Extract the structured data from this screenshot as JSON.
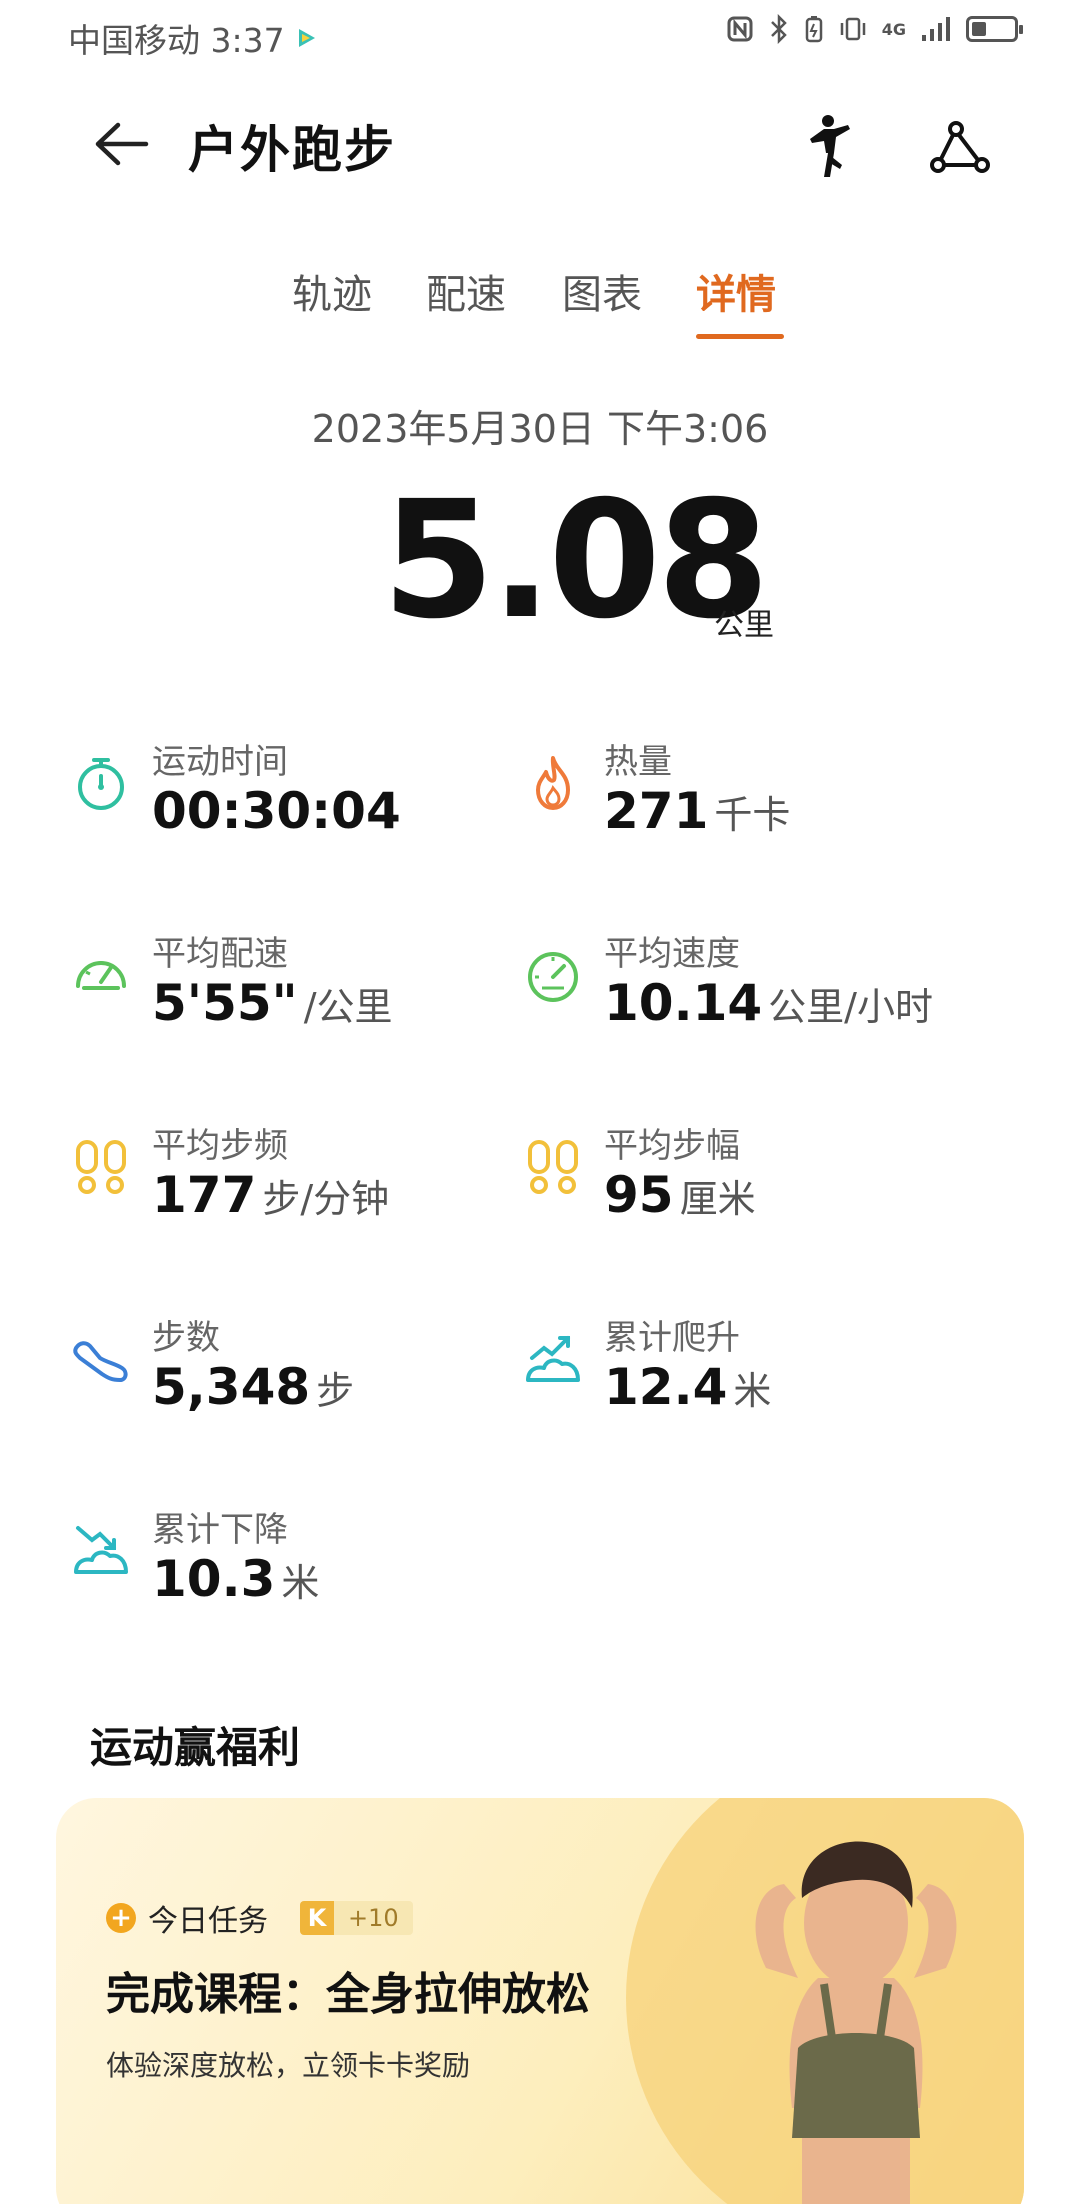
{
  "status_bar": {
    "carrier_time": "中国移动 3:37",
    "network": "4G",
    "icons": [
      "nfc-icon",
      "bluetooth-icon",
      "battery-saver-icon",
      "vibrate-icon",
      "signal-icon",
      "battery-icon"
    ],
    "battery_level": 0.35
  },
  "header": {
    "title": "户外跑步",
    "icons": [
      "back-arrow-icon",
      "runner-icon",
      "route-icon"
    ]
  },
  "tabs": [
    {
      "label": "轨迹",
      "active": false
    },
    {
      "label": "配速",
      "active": false
    },
    {
      "label": "图表",
      "active": false
    },
    {
      "label": "详情",
      "active": true
    }
  ],
  "summary": {
    "date": "2023年5月30日 下午3:06",
    "distance": "5.08",
    "distance_unit": "公里"
  },
  "stats": [
    {
      "label": "运动时间",
      "value": "00:30:04",
      "unit": "",
      "icon": "stopwatch-icon",
      "color": "#2fbfa0"
    },
    {
      "label": "热量",
      "value": "271",
      "unit": "千卡",
      "icon": "flame-icon",
      "color": "#ef7a3a"
    },
    {
      "label": "平均配速",
      "value": "5'55\"",
      "unit": "/公里",
      "icon": "speedometer-icon",
      "color": "#5cc35c"
    },
    {
      "label": "平均速度",
      "value": "10.14",
      "unit": "公里/小时",
      "icon": "gauge-icon",
      "color": "#5cc35c"
    },
    {
      "label": "平均步频",
      "value": "177",
      "unit": "步/分钟",
      "icon": "footprints-icon",
      "color": "#f2c03a"
    },
    {
      "label": "平均步幅",
      "value": "95",
      "unit": "厘米",
      "icon": "footprints-icon",
      "color": "#f2c03a"
    },
    {
      "label": "步数",
      "value": "5,348",
      "unit": "步",
      "icon": "shoe-icon",
      "color": "#3b7fd6"
    },
    {
      "label": "累计爬升",
      "value": "12.4",
      "unit": "米",
      "icon": "climb-icon",
      "color": "#2cb7c2"
    },
    {
      "label": "累计下降",
      "value": "10.3",
      "unit": "米",
      "icon": "descent-icon",
      "color": "#2cb7c2"
    }
  ],
  "section": {
    "title": "运动赢福利"
  },
  "promo": {
    "task_label": "今日任务",
    "badge_letter": "K",
    "badge_points": "+10",
    "title": "完成课程：全身拉伸放松",
    "subtitle": "体验深度放松，立领卡卡奖励"
  },
  "colors": {
    "accent": "#e0691f",
    "text_primary": "#111111",
    "text_secondary": "#666666"
  }
}
